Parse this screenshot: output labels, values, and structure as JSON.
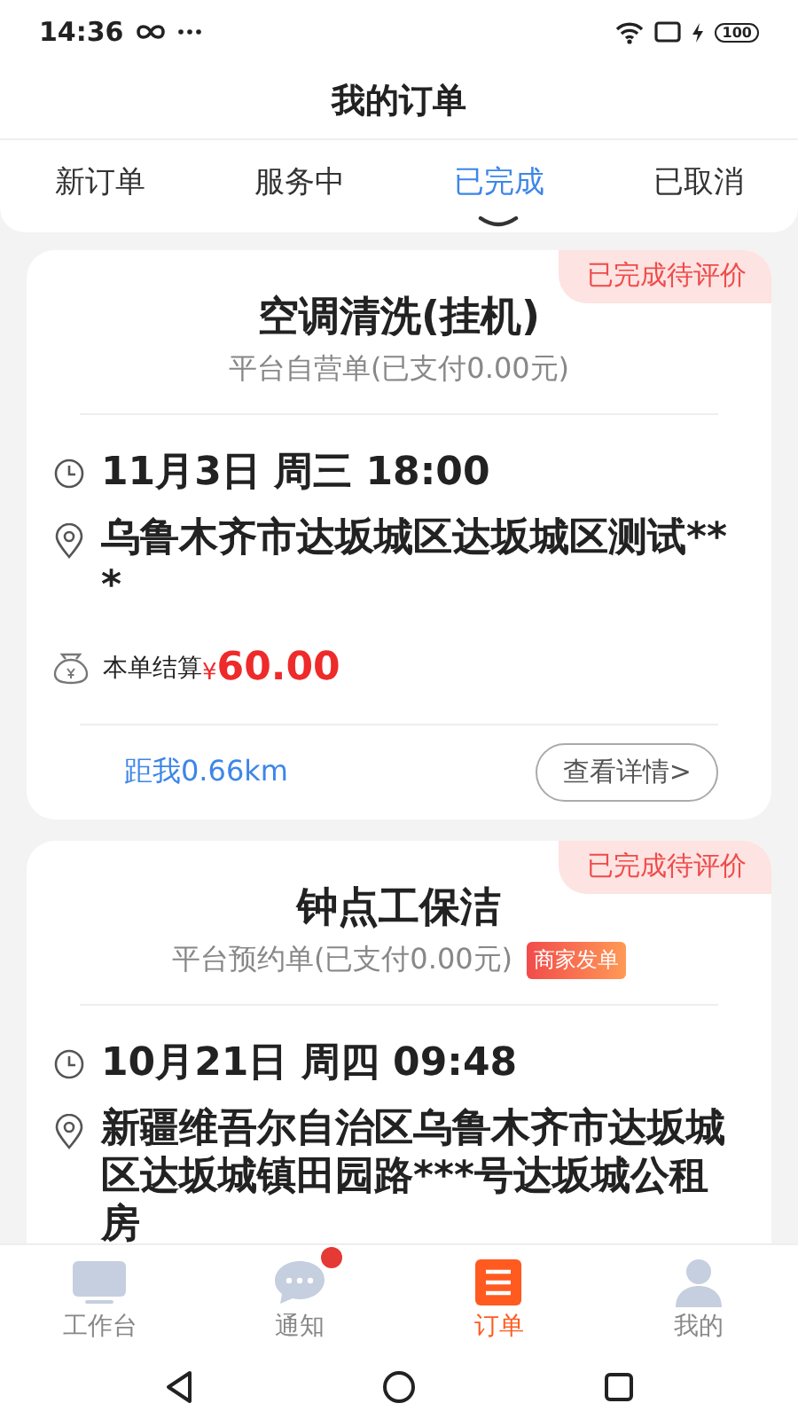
{
  "status_bar": {
    "time": "14:36",
    "battery": "100"
  },
  "header": {
    "title": "我的订单"
  },
  "tabs": [
    {
      "label": "新订单",
      "selected": false
    },
    {
      "label": "服务中",
      "selected": false
    },
    {
      "label": "已完成",
      "selected": true
    },
    {
      "label": "已取消",
      "selected": false
    }
  ],
  "orders": [
    {
      "status_badge": "已完成待评价",
      "title": "空调清洗(挂机)",
      "subtitle": "平台自营单(已支付0.00元)",
      "time": "11月3日 周三 18:00",
      "address": "乌鲁木齐市达坂城区达坂城区测试***",
      "settlement_label": "本单结算",
      "currency": "¥",
      "amount": "60.00",
      "distance": "距我0.66km",
      "detail_button": "查看详情>"
    },
    {
      "status_badge": "已完成待评价",
      "title": "钟点工保洁",
      "subtitle": "平台预约单(已支付0.00元)",
      "tag": "商家发单",
      "time": "10月21日 周四 09:48",
      "address": "新疆维吾尔自治区乌鲁木齐市达坂城区达坂城镇田园路***号达坂城公租房"
    }
  ],
  "bottom_nav": [
    {
      "kind": "desk",
      "label": "工作台",
      "selected": false,
      "dot": false
    },
    {
      "kind": "chat",
      "label": "通知",
      "selected": false,
      "dot": true
    },
    {
      "kind": "list",
      "label": "订单",
      "selected": true,
      "dot": false
    },
    {
      "kind": "person",
      "label": "我的",
      "selected": false,
      "dot": false
    }
  ]
}
